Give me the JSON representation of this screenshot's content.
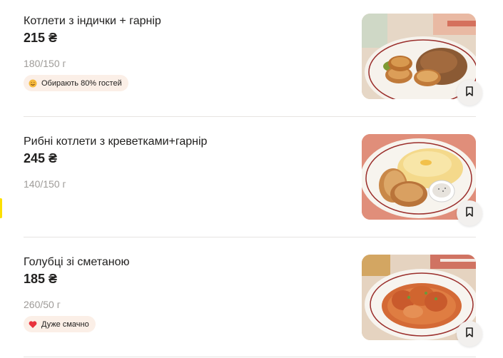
{
  "items": [
    {
      "title": "Котлети з індички + гарнір",
      "price": "215 ₴",
      "weight": "180/150 г",
      "badge": {
        "icon": "star-face-icon",
        "label": "Обирають 80% гостей"
      }
    },
    {
      "title": "Рибні котлети з креветками+гарнір",
      "price": "245 ₴",
      "weight": "140/150 г",
      "badge": null
    },
    {
      "title": "Голубці зі сметаною",
      "price": "185 ₴",
      "weight": "260/50 г",
      "badge": {
        "icon": "heart-icon",
        "label": "Дуже смачно"
      }
    }
  ],
  "colors": {
    "badge_bg": "#fbefe7",
    "heart": "#e8323c",
    "accent_marker": "#fce000"
  }
}
